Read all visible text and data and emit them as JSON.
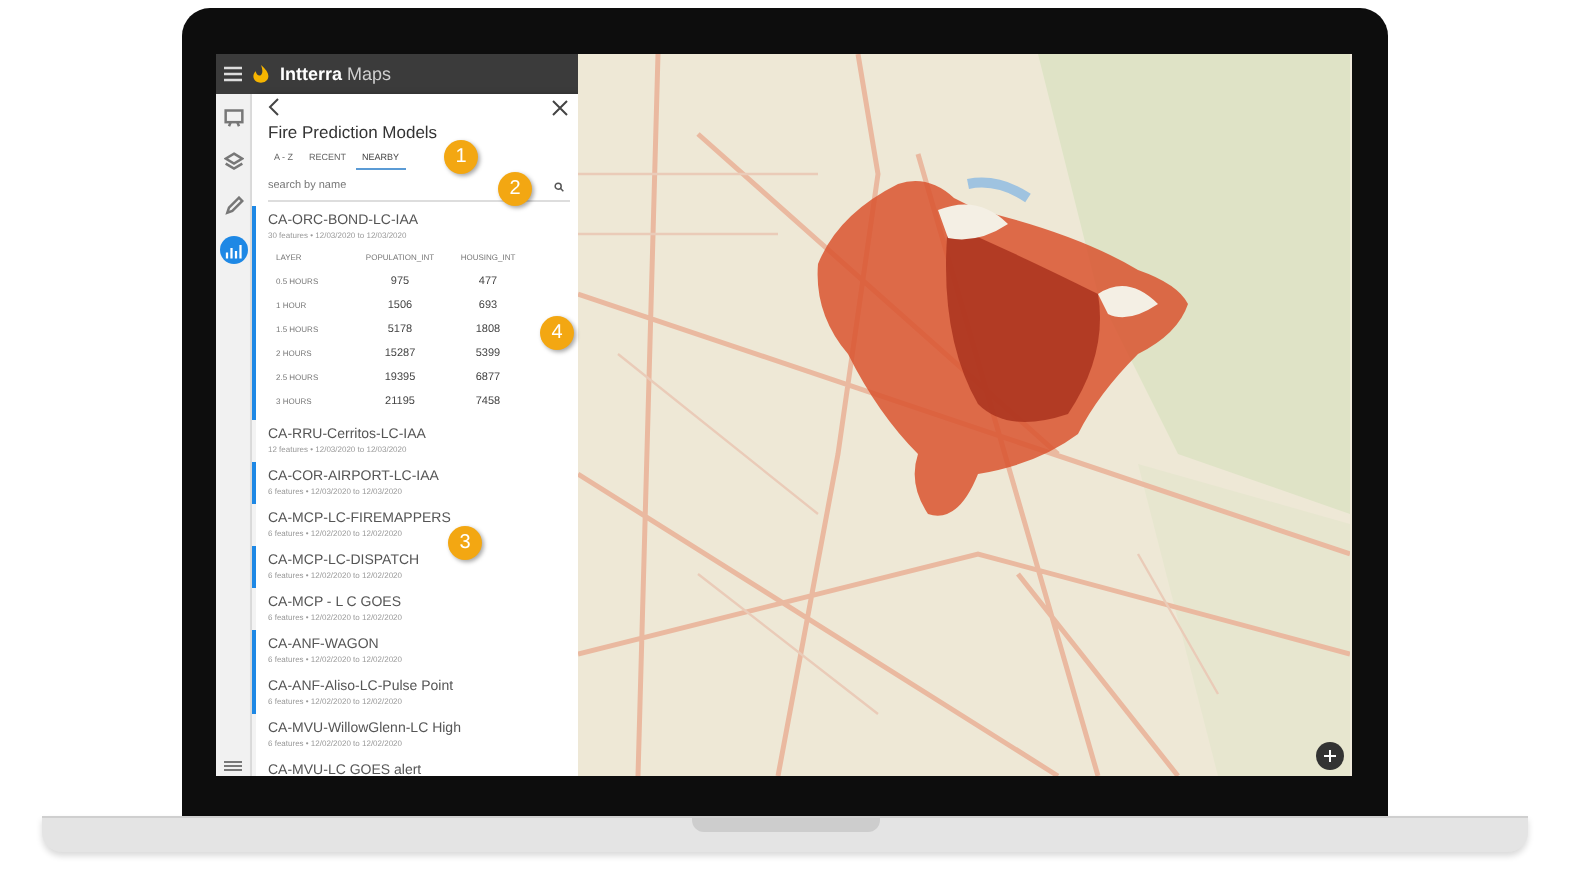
{
  "app": {
    "brand": "Intterra",
    "product": "Maps"
  },
  "rail_items": [
    {
      "kind": "board",
      "selected": false
    },
    {
      "kind": "layers",
      "selected": false
    },
    {
      "kind": "pencil",
      "selected": false
    },
    {
      "kind": "chart",
      "selected": true
    }
  ],
  "panel": {
    "title": "Fire Prediction Models",
    "tabs": [
      {
        "label": "A - Z",
        "selected": false
      },
      {
        "label": "RECENT",
        "selected": false
      },
      {
        "label": "NEARBY",
        "selected": true
      }
    ],
    "search": {
      "placeholder": "search by name"
    },
    "items": [
      {
        "name": "CA-ORC-BOND-LC-IAA",
        "meta": "30 features • 12/03/2020 to 12/03/2020",
        "highlighted": true,
        "table": {
          "columns": [
            "LAYER",
            "POPULATION_INT",
            "HOUSING_INT"
          ],
          "rows": [
            [
              "0.5 HOURS",
              "975",
              "477"
            ],
            [
              "1 HOUR",
              "1506",
              "693"
            ],
            [
              "1.5 HOURS",
              "5178",
              "1808"
            ],
            [
              "2 HOURS",
              "15287",
              "5399"
            ],
            [
              "2.5 HOURS",
              "19395",
              "6877"
            ],
            [
              "3 HOURS",
              "21195",
              "7458"
            ]
          ]
        }
      },
      {
        "name": "CA-RRU-Cerritos-LC-IAA",
        "meta": "12 features • 12/03/2020 to 12/03/2020",
        "highlighted": false
      },
      {
        "name": "CA-COR-AIRPORT-LC-IAA",
        "meta": "6 features • 12/03/2020 to 12/03/2020",
        "highlighted": true
      },
      {
        "name": "CA-MCP-LC-FIREMAPPERS",
        "meta": "6 features • 12/02/2020 to 12/02/2020",
        "highlighted": false
      },
      {
        "name": "CA-MCP-LC-DISPATCH",
        "meta": "6 features • 12/02/2020 to 12/02/2020",
        "highlighted": true
      },
      {
        "name": "CA-MCP - L C GOES",
        "meta": "6 features • 12/02/2020 to 12/02/2020",
        "highlighted": false
      },
      {
        "name": "CA-ANF-WAGON",
        "meta": "6 features • 12/02/2020 to 12/02/2020",
        "highlighted": true
      },
      {
        "name": "CA-ANF-Aliso-LC-Pulse Point",
        "meta": "6 features • 12/02/2020 to 12/02/2020",
        "highlighted": true
      },
      {
        "name": "CA-MVU-WillowGlenn-LC High",
        "meta": "6 features • 12/02/2020 to 12/02/2020",
        "highlighted": false
      },
      {
        "name": "CA-MVU-LC GOES alert",
        "highlighted": false
      }
    ]
  },
  "callouts": [
    "1",
    "2",
    "3",
    "4"
  ]
}
